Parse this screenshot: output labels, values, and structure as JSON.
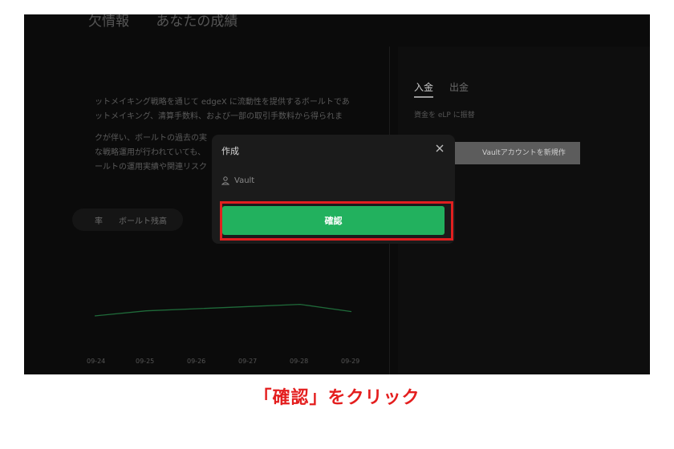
{
  "background_page": {
    "top_tabs": [
      "欠情報",
      "あなたの成績"
    ],
    "description_lines": [
      "ットメイキング戦略を通じて edgeX に流動性を提供するボールトであ",
      "ットメイキング、清算手数料、および一部の取引手数料から得られま",
      "クが伴い、ボールトの過去の実",
      "な戦略運用が行われていても、",
      "ールトの運用実績や関連リスク"
    ],
    "legend_partial": "率",
    "legend_label": "ボールト残高",
    "x_ticks": [
      "09-24",
      "09-25",
      "09-26",
      "09-27",
      "09-28",
      "09-29"
    ],
    "series_relative": [
      0.0,
      0.35,
      0.5,
      0.65,
      0.8,
      0.3
    ],
    "right_panel": {
      "tab_deposit": "入金",
      "tab_withdraw": "出金",
      "convert_note": "資金を eLP に振替",
      "create_vault_button": "Vaultアカウントを新規作"
    }
  },
  "modal": {
    "title": "作成",
    "vault_label": "Vault",
    "confirm_label": "確認"
  },
  "caption": "「確認」をクリック",
  "colors": {
    "accent_green": "#22b15e",
    "highlight_red": "#e02020",
    "caption_red": "#e41e1e",
    "chart_line": "#1f6b3a"
  }
}
